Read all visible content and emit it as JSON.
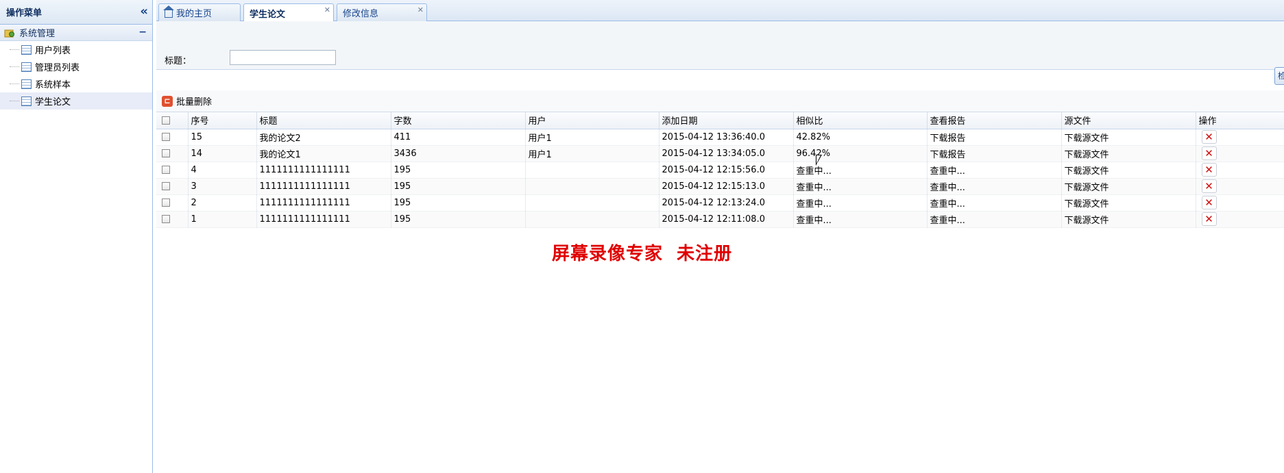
{
  "sidebar": {
    "title": "操作菜单",
    "collapse_icon": "«",
    "group": {
      "label": "系统管理",
      "toggle": "−"
    },
    "items": [
      {
        "label": "用户列表"
      },
      {
        "label": "管理员列表"
      },
      {
        "label": "系统样本"
      },
      {
        "label": "学生论文",
        "active": true
      }
    ]
  },
  "tabs": [
    {
      "label": "我的主页",
      "icon": "home-icon",
      "closable": false
    },
    {
      "label": "学生论文",
      "closable": true,
      "active": true
    },
    {
      "label": "修改信息",
      "closable": true
    }
  ],
  "search": {
    "title_label": "标题：",
    "title_value": "",
    "search_button": "检"
  },
  "toolbar": {
    "batch_delete": "批量删除"
  },
  "table": {
    "headers": [
      "序号",
      "标题",
      "字数",
      "用户",
      "添加日期",
      "相似比",
      "查看报告",
      "源文件",
      "操作"
    ],
    "rows": [
      {
        "id": "15",
        "title": "我的论文2",
        "words": "411",
        "user": "用户1",
        "date": "2015-04-12 13:36:40.0",
        "similarity": "42.82%",
        "report": "下载报告",
        "source": "下载源文件"
      },
      {
        "id": "14",
        "title": "我的论文1",
        "words": "3436",
        "user": "用户1",
        "date": "2015-04-12 13:34:05.0",
        "similarity": "96.42%",
        "report": "下载报告",
        "source": "下载源文件"
      },
      {
        "id": "4",
        "title": "1111111111111111",
        "words": "195",
        "user": "",
        "date": "2015-04-12 12:15:56.0",
        "similarity": "查重中...",
        "report": "查重中...",
        "source": "下载源文件"
      },
      {
        "id": "3",
        "title": "1111111111111111",
        "words": "195",
        "user": "",
        "date": "2015-04-12 12:15:13.0",
        "similarity": "查重中...",
        "report": "查重中...",
        "source": "下载源文件"
      },
      {
        "id": "2",
        "title": "1111111111111111",
        "words": "195",
        "user": "",
        "date": "2015-04-12 12:13:24.0",
        "similarity": "查重中...",
        "report": "查重中...",
        "source": "下载源文件"
      },
      {
        "id": "1",
        "title": "1111111111111111",
        "words": "195",
        "user": "",
        "date": "2015-04-12 12:11:08.0",
        "similarity": "查重中...",
        "report": "查重中...",
        "source": "下载源文件"
      }
    ],
    "delete_glyph": "✕"
  },
  "watermark": "屏幕录像专家  未注册",
  "colors": {
    "accent": "#15428b",
    "border": "#99bbe8",
    "delete": "#d01010",
    "watermark": "#e00000"
  }
}
